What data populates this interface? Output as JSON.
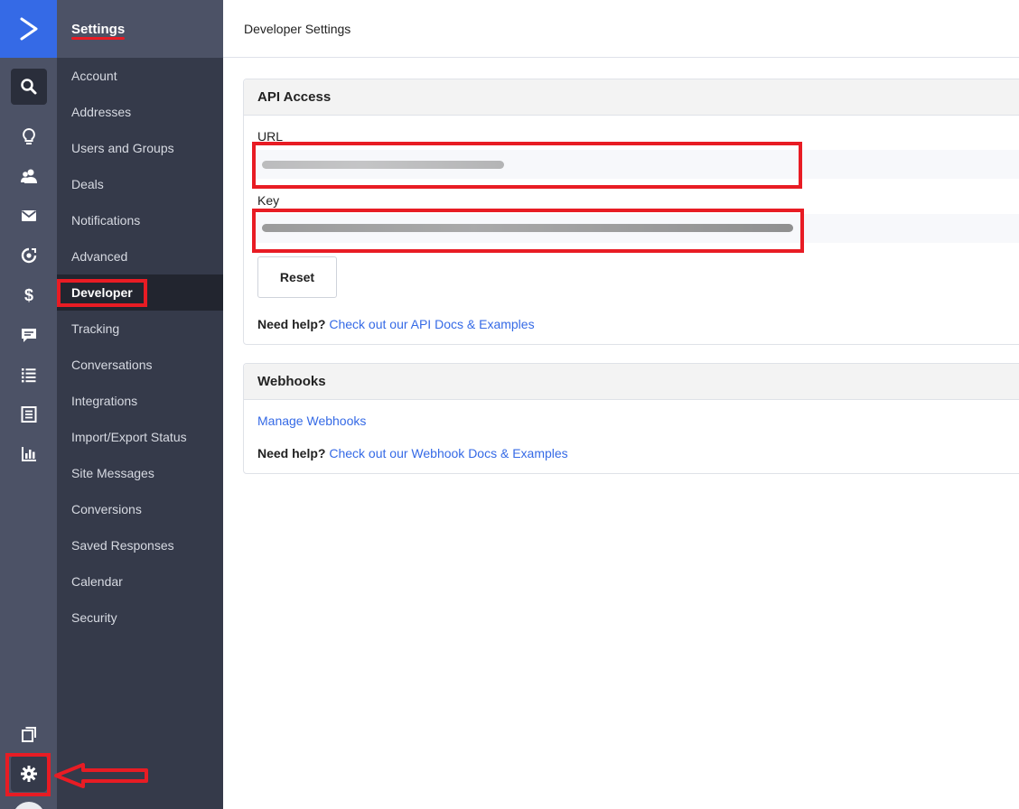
{
  "rail": {
    "icons": [
      "activecampaign-logo-icon",
      "search-icon",
      "lightbulb-icon",
      "contacts-icon",
      "email-icon",
      "automation-icon",
      "dollar-icon",
      "conversations-icon",
      "lists-icon",
      "forms-icon",
      "reports-icon",
      "pages-icon",
      "gear-icon"
    ]
  },
  "settings": {
    "title": "Settings",
    "items": [
      {
        "label": "Account"
      },
      {
        "label": "Addresses"
      },
      {
        "label": "Users and Groups"
      },
      {
        "label": "Deals"
      },
      {
        "label": "Notifications"
      },
      {
        "label": "Advanced"
      },
      {
        "label": "Developer",
        "active": true
      },
      {
        "label": "Tracking"
      },
      {
        "label": "Conversations"
      },
      {
        "label": "Integrations"
      },
      {
        "label": "Import/Export Status"
      },
      {
        "label": "Site Messages"
      },
      {
        "label": "Conversions"
      },
      {
        "label": "Saved Responses"
      },
      {
        "label": "Calendar"
      },
      {
        "label": "Security"
      }
    ]
  },
  "header": {
    "title": "Developer Settings"
  },
  "api_access": {
    "title": "API Access",
    "url_label": "URL",
    "key_label": "Key",
    "reset_label": "Reset",
    "help_prefix": "Need help?",
    "help_link": "Check out our API Docs & Examples"
  },
  "webhooks": {
    "title": "Webhooks",
    "manage_link": "Manage Webhooks",
    "help_prefix": "Need help?",
    "help_link": "Check out our Webhook Docs & Examples"
  },
  "colors": {
    "accent": "#356ae6",
    "rail_bg": "#4c5266",
    "sidebar_bg": "#353a4a",
    "annotation": "#e81c24"
  }
}
